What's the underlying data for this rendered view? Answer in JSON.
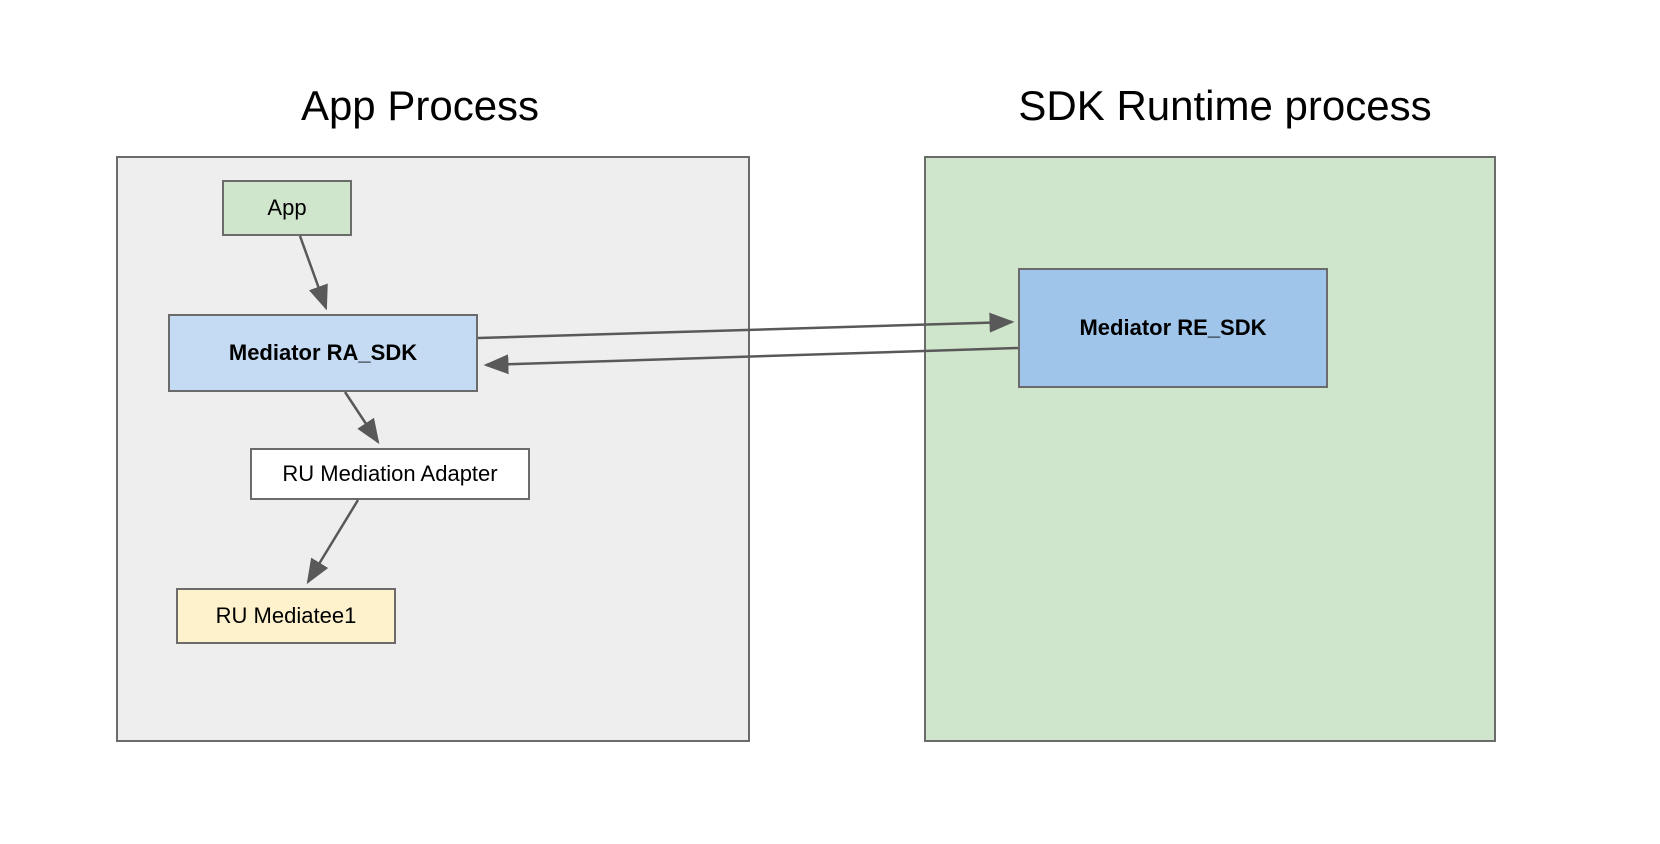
{
  "containers": {
    "app_process": {
      "title": "App Process"
    },
    "sdk_runtime": {
      "title": "SDK Runtime process"
    }
  },
  "boxes": {
    "app": {
      "label": "App"
    },
    "mediator_ra_sdk": {
      "label": "Mediator RA_SDK"
    },
    "ru_mediation_adapter": {
      "label": "RU Mediation Adapter"
    },
    "ru_mediatee1": {
      "label": "RU Mediatee1"
    },
    "mediator_re_sdk": {
      "label": "Mediator RE_SDK"
    }
  },
  "colors": {
    "app_process_bg": "#eeeeee",
    "sdk_runtime_bg": "#d0e6cc",
    "app_bg": "#d0e6cc",
    "mediator_ra_bg": "#c5dbf4",
    "adapter_bg": "#ffffff",
    "mediatee_bg": "#fdf2cc",
    "mediator_re_bg": "#a0c5ea"
  }
}
